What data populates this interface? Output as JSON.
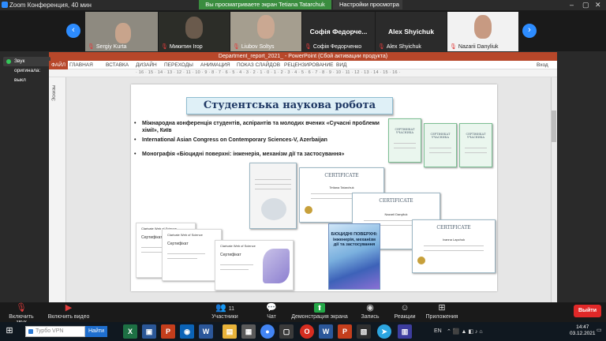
{
  "window": {
    "title": "Zoom Конференция, 40 мин"
  },
  "banner": {
    "sharing": "Вы просматриваете экран Tetiana Tatarchuk",
    "view_options": "Настройки просмотра"
  },
  "participants": [
    {
      "name": "Sergiy Kurta"
    },
    {
      "name": "Микитин Ігор"
    },
    {
      "name": "Liubov Soltys"
    },
    {
      "name": "Софія Федорченко",
      "display": "Софія Федорче..."
    },
    {
      "name": "Alex Shyichuk",
      "display": "Alex Shyichuk"
    },
    {
      "name": "Nazarii Danyliuk"
    }
  ],
  "notice": {
    "original_sound": "Звук оригинала: выкл"
  },
  "powerpoint": {
    "title": "Department_report_2021_ - PowerPoint (Сбой активации продукта)",
    "tabs": [
      "ФАЙЛ",
      "ГЛАВНАЯ",
      "ВСТАВКА",
      "ДИЗАЙН",
      "ПЕРЕХОДЫ",
      "АНИМАЦИЯ",
      "ПОКАЗ СЛАЙДОВ",
      "РЕЦЕНЗИРОВАНИЕ",
      "ВИД"
    ],
    "login": "Вход",
    "ruler": "· 16 · 15 · 14 · 13 · 12 · 11 · 10 · 9 · 8 · 7 · 6 · 5 · 4 · 3 · 2 · 1 · 0 · 1 · 2 · 3 · 4 · 5 · 6 · 7 · 8 · 9 · 10 · 11 · 12 · 13 · 14 · 15 · 16 ·",
    "slides_pane": "Эскизы"
  },
  "slide": {
    "title": "Студентська наукова робота",
    "bullets": [
      "Міжнародна конференція студентів, аспірантів та молодих вчених «Сучасні проблеми хімії», Київ",
      "International Asian Congress on Contemporary Sciences-V, Azerbaijan",
      "Монографія «Біоцидні поверхні: інженерія, механізм дії та застосування»"
    ],
    "certificate_green": "СЕРТИФІКАТ УЧАСНИКА",
    "certificate_en": "CERTIFICATE",
    "cert_names": [
      "Tetiana Tatarchuk",
      "Nazarii Danyliuk",
      "Ivanna Lapchuk"
    ],
    "wos_logo": "Clarivate Web of Science",
    "wos_title": "Сертифікат",
    "book_title": "БІОЦИДНІ ПОВЕРХНІ: інженерія, механізм дії та застосування"
  },
  "toolbar": {
    "unmute": "Включить звук",
    "start_video": "Включить видео",
    "participants": "Участники",
    "participants_count": "11",
    "chat": "Чат",
    "share_screen": "Демонстрация экрана",
    "record": "Запись",
    "reactions": "Реакции",
    "apps": "Приложения",
    "leave": "Выйти"
  },
  "taskbar": {
    "search_placeholder": "Турбо VPN",
    "search_button": "Найти",
    "lang": "EN",
    "time": "14:47",
    "date": "03.12.2021"
  },
  "colors": {
    "zoom_blue": "#2d8cff",
    "share_green": "#3a8d3f",
    "ppt_red": "#b7472a",
    "leave_red": "#e02828"
  }
}
